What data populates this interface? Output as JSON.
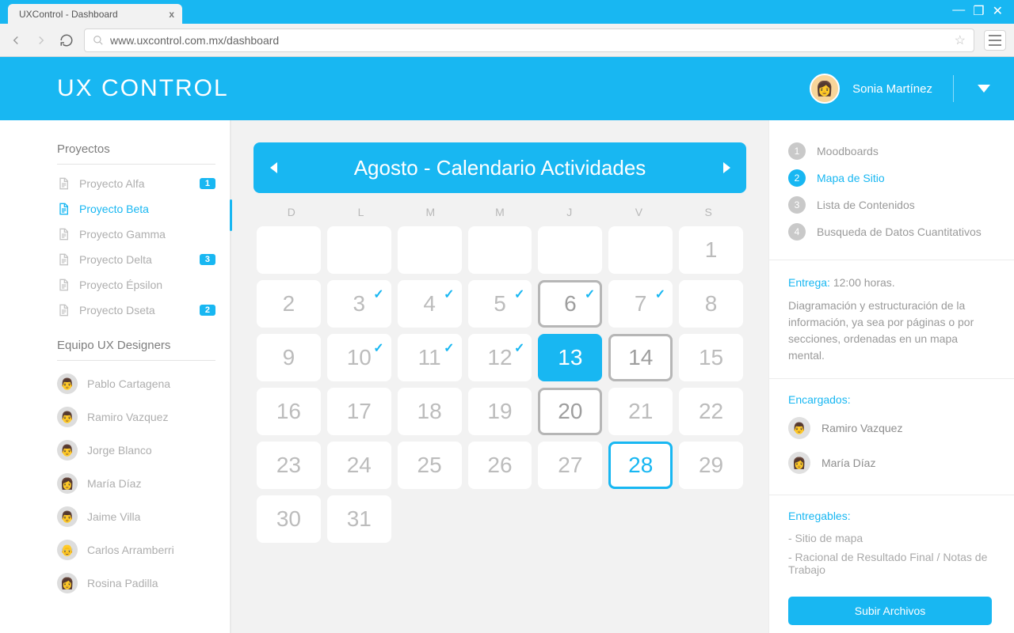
{
  "browser": {
    "tab_title": "UXControl - Dashboard",
    "url": "www.uxcontrol.com.mx/dashboard"
  },
  "header": {
    "brand_bold": "UX",
    "brand_light": " CONTROL",
    "user_name": "Sonia Martínez"
  },
  "sidebar": {
    "projects_title": "Proyectos",
    "projects": [
      {
        "label": "Proyecto Alfa",
        "badge": "1",
        "active": false
      },
      {
        "label": "Proyecto Beta",
        "badge": "",
        "active": true
      },
      {
        "label": "Proyecto Gamma",
        "badge": "",
        "active": false
      },
      {
        "label": "Proyecto Delta",
        "badge": "3",
        "active": false
      },
      {
        "label": "Proyecto Épsilon",
        "badge": "",
        "active": false
      },
      {
        "label": "Proyecto Dseta",
        "badge": "2",
        "active": false
      }
    ],
    "team_title": "Equipo UX Designers",
    "team": [
      {
        "name": "Pablo Cartagena"
      },
      {
        "name": "Ramiro Vazquez"
      },
      {
        "name": "Jorge Blanco"
      },
      {
        "name": "María Díaz"
      },
      {
        "name": "Jaime Villa"
      },
      {
        "name": "Carlos Arramberri"
      },
      {
        "name": "Rosina Padilla"
      }
    ]
  },
  "calendar": {
    "title_bold": "Agosto - ",
    "title_light": "Calendario Actividades",
    "dow": [
      "D",
      "L",
      "M",
      "M",
      "J",
      "V",
      "S"
    ],
    "cells": [
      {
        "n": "",
        "t": "empty"
      },
      {
        "n": "",
        "t": "empty"
      },
      {
        "n": "",
        "t": "empty"
      },
      {
        "n": "",
        "t": "empty"
      },
      {
        "n": "",
        "t": "empty"
      },
      {
        "n": "",
        "t": "empty"
      },
      {
        "n": "1",
        "t": ""
      },
      {
        "n": "2",
        "t": ""
      },
      {
        "n": "3",
        "t": "",
        "m": "check"
      },
      {
        "n": "4",
        "t": "",
        "m": "check"
      },
      {
        "n": "5",
        "t": "",
        "m": "check"
      },
      {
        "n": "6",
        "t": "greyb",
        "m": "check"
      },
      {
        "n": "7",
        "t": "",
        "m": "check"
      },
      {
        "n": "8",
        "t": ""
      },
      {
        "n": "9",
        "t": ""
      },
      {
        "n": "10",
        "t": "",
        "m": "check"
      },
      {
        "n": "11",
        "t": "",
        "m": "check"
      },
      {
        "n": "12",
        "t": "",
        "m": "check"
      },
      {
        "n": "13",
        "t": "bluefill",
        "m": "wdot"
      },
      {
        "n": "14",
        "t": "greyb",
        "m": "dot"
      },
      {
        "n": "15",
        "t": ""
      },
      {
        "n": "16",
        "t": ""
      },
      {
        "n": "17",
        "t": "",
        "m": "dot"
      },
      {
        "n": "18",
        "t": "",
        "m": "dot"
      },
      {
        "n": "19",
        "t": "",
        "m": "dot"
      },
      {
        "n": "20",
        "t": "greyb",
        "m": "dot"
      },
      {
        "n": "21",
        "t": "",
        "m": "dot"
      },
      {
        "n": "22",
        "t": ""
      },
      {
        "n": "23",
        "t": ""
      },
      {
        "n": "24",
        "t": "",
        "m": "dot"
      },
      {
        "n": "25",
        "t": "",
        "m": "dot"
      },
      {
        "n": "26",
        "t": "",
        "m": "dot"
      },
      {
        "n": "27",
        "t": "",
        "m": "dot"
      },
      {
        "n": "28",
        "t": "blueb",
        "m": "dot"
      },
      {
        "n": "29",
        "t": ""
      },
      {
        "n": "30",
        "t": ""
      },
      {
        "n": "31",
        "t": ""
      }
    ]
  },
  "panel": {
    "steps": [
      {
        "n": "1",
        "label": "Moodboards",
        "active": false
      },
      {
        "n": "2",
        "label": "Mapa de Sitio",
        "active": true
      },
      {
        "n": "3",
        "label": "Lista de Contenidos",
        "active": false
      },
      {
        "n": "4",
        "label": "Busqueda de Datos Cuantitativos",
        "active": false
      }
    ],
    "delivery_label": "Entrega:",
    "delivery_value": " 12:00 horas.",
    "description": "Diagramación y estructuración de la información, ya sea por páginas o por secciones, ordenadas en un mapa mental.",
    "assignees_title": "Encargados:",
    "assignees": [
      {
        "name": "Ramiro Vazquez"
      },
      {
        "name": "María Díaz"
      }
    ],
    "deliverables_title": "Entregables:",
    "deliverables": [
      "- Sitio de mapa",
      "- Racional de Resultado Final / Notas de Trabajo"
    ],
    "upload_label": "Subir Archivos"
  }
}
